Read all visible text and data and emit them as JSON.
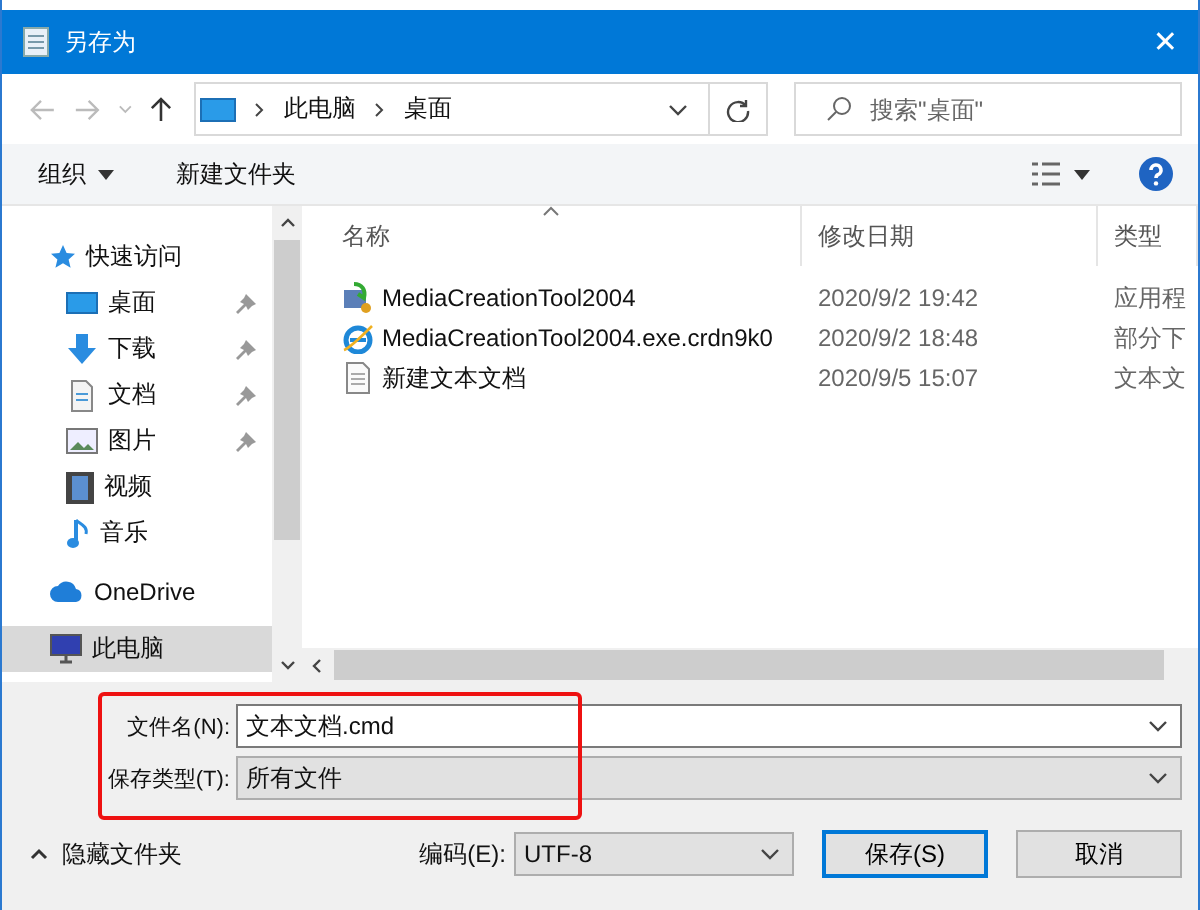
{
  "window": {
    "title": "另存为",
    "close": "✕"
  },
  "nav": {
    "path": [
      "此电脑",
      "桌面"
    ],
    "search": {
      "placeholder": "搜索\"桌面\""
    }
  },
  "toolbar": {
    "organize": "组织",
    "new_folder": "新建文件夹"
  },
  "sidebar": [
    {
      "label": "快速访问",
      "kind": "star",
      "selected": false,
      "pinned": false,
      "children": [
        {
          "label": "桌面",
          "kind": "desktop",
          "selected": false,
          "pinned": true
        },
        {
          "label": "下载",
          "kind": "download",
          "selected": false,
          "pinned": true
        },
        {
          "label": "文档",
          "kind": "document",
          "selected": false,
          "pinned": true
        },
        {
          "label": "图片",
          "kind": "pictures",
          "selected": false,
          "pinned": true
        },
        {
          "label": "视频",
          "kind": "video",
          "selected": false,
          "pinned": false
        },
        {
          "label": "音乐",
          "kind": "music",
          "selected": false,
          "pinned": false
        }
      ]
    },
    {
      "label": "OneDrive",
      "kind": "cloud",
      "selected": false,
      "pinned": false
    },
    {
      "label": "此电脑",
      "kind": "pc",
      "selected": true,
      "pinned": false
    }
  ],
  "columns": [
    {
      "label": "名称",
      "sorted": true
    },
    {
      "label": "修改日期",
      "sorted": false
    },
    {
      "label": "类型",
      "sorted": false
    }
  ],
  "rows": [
    {
      "kind": "installer",
      "name": "MediaCreationTool2004",
      "date": "2020/9/2 19:42",
      "type": "应用程"
    },
    {
      "kind": "web",
      "name": "MediaCreationTool2004.exe.crdn9k0",
      "date": "2020/9/2 18:48",
      "type": "部分下"
    },
    {
      "kind": "text",
      "name": "新建文本文档",
      "date": "2020/9/5 15:07",
      "type": "文本文"
    }
  ],
  "form": {
    "file_name": {
      "label": "文件名(N):",
      "value": "文本文档.cmd"
    },
    "file_type": {
      "label": "保存类型(T):",
      "value": "所有文件"
    },
    "hide_folders": "隐藏文件夹",
    "encoding": {
      "label": "编码(E):",
      "value": "UTF-8"
    },
    "buttons": [
      {
        "label": "保存(S)",
        "default": true
      },
      {
        "label": "取消",
        "default": false
      }
    ]
  }
}
